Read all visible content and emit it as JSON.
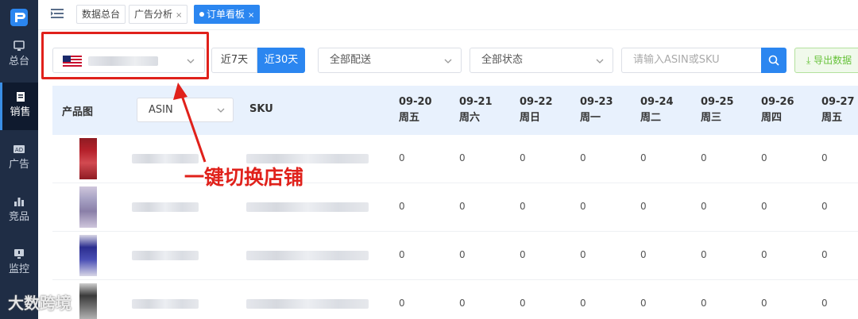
{
  "sidebar": {
    "items": [
      {
        "label": "总台",
        "icon": "monitor-icon"
      },
      {
        "label": "销售",
        "icon": "document-icon",
        "active": true
      },
      {
        "label": "广告",
        "icon": "ad-icon"
      },
      {
        "label": "竞品",
        "icon": "bar-chart-icon"
      },
      {
        "label": "监控",
        "icon": "monitor-alert-icon"
      }
    ]
  },
  "tabs": [
    {
      "label": "数据总台",
      "closable": false
    },
    {
      "label": "广告分析",
      "closable": true
    },
    {
      "label": "订单看板",
      "closable": true,
      "active": true
    }
  ],
  "filters": {
    "period_7": "近7天",
    "period_30": "近30天",
    "delivery": "全部配送",
    "status": "全部状态",
    "search_placeholder": "请输入ASIN或SKU",
    "export": "导出数据"
  },
  "table": {
    "col_image": "产品图",
    "col_asin": "ASIN",
    "col_sku": "SKU",
    "days": [
      {
        "date": "09-20",
        "weekday": "周五"
      },
      {
        "date": "09-21",
        "weekday": "周六"
      },
      {
        "date": "09-22",
        "weekday": "周日"
      },
      {
        "date": "09-23",
        "weekday": "周一"
      },
      {
        "date": "09-24",
        "weekday": "周二"
      },
      {
        "date": "09-25",
        "weekday": "周三"
      },
      {
        "date": "09-26",
        "weekday": "周四"
      },
      {
        "date": "09-27",
        "weekday": "周五"
      }
    ],
    "rows": [
      {
        "values": [
          "0",
          "0",
          "0",
          "0",
          "0",
          "0",
          "0",
          "0"
        ]
      },
      {
        "values": [
          "0",
          "0",
          "0",
          "0",
          "0",
          "0",
          "0",
          "0"
        ]
      },
      {
        "values": [
          "0",
          "0",
          "0",
          "0",
          "0",
          "0",
          "0",
          "0"
        ]
      },
      {
        "values": [
          "0",
          "0",
          "0",
          "0",
          "0",
          "0",
          "0",
          "0"
        ]
      }
    ]
  },
  "annotation": "一键切换店铺",
  "watermark": "大数跨境",
  "colors": {
    "accent": "#2b86f0",
    "highlight": "#e0211b",
    "sidebar": "#1f2d45"
  }
}
